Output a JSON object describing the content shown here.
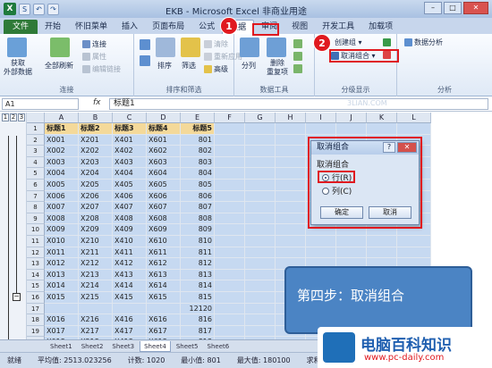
{
  "window": {
    "title": "EKB - Microsoft Excel 非商业用途"
  },
  "qat": {
    "save": "S",
    "undo": "↶",
    "redo": "↷"
  },
  "tabs": [
    "文件",
    "开始",
    "怀旧菜单",
    "插入",
    "页面布局",
    "公式",
    "数据",
    "审阅",
    "视图",
    "开发工具",
    "加载项"
  ],
  "ribbon": {
    "get_external": "获取\n外部数据",
    "refresh_all": "全部刷新",
    "connections": "连接",
    "properties": "属性",
    "edit_links": "编辑链接",
    "group_connections": "连接",
    "sort": "排序",
    "filter": "筛选",
    "clear": "清除",
    "reapply": "重新应用",
    "advanced": "高级",
    "group_sort": "排序和筛选",
    "split": "分列",
    "remove_dup": "删除\n重复项",
    "group_tools": "数据工具",
    "group": "创建组",
    "ungroup": "取消组合",
    "group_outline": "分级显示",
    "data_analysis": "数据分析",
    "group_analysis": "分析"
  },
  "formula": {
    "namebox": "A1",
    "fx": "fx",
    "value": "标题1"
  },
  "columns": [
    "A",
    "B",
    "C",
    "D",
    "E",
    "F",
    "G",
    "H",
    "I",
    "J",
    "K",
    "L"
  ],
  "rows": [
    {
      "n": "1",
      "c": [
        "标题1",
        "标题2",
        "标题3",
        "标题4",
        "标题5"
      ]
    },
    {
      "n": "2",
      "c": [
        "X001",
        "X201",
        "X401",
        "X601",
        "801"
      ]
    },
    {
      "n": "3",
      "c": [
        "X002",
        "X202",
        "X402",
        "X602",
        "802"
      ]
    },
    {
      "n": "4",
      "c": [
        "X003",
        "X203",
        "X403",
        "X603",
        "803"
      ]
    },
    {
      "n": "5",
      "c": [
        "X004",
        "X204",
        "X404",
        "X604",
        "804"
      ]
    },
    {
      "n": "6",
      "c": [
        "X005",
        "X205",
        "X405",
        "X605",
        "805"
      ]
    },
    {
      "n": "7",
      "c": [
        "X006",
        "X206",
        "X406",
        "X606",
        "806"
      ]
    },
    {
      "n": "8",
      "c": [
        "X007",
        "X207",
        "X407",
        "X607",
        "807"
      ]
    },
    {
      "n": "9",
      "c": [
        "X008",
        "X208",
        "X408",
        "X608",
        "808"
      ]
    },
    {
      "n": "10",
      "c": [
        "X009",
        "X209",
        "X409",
        "X609",
        "809"
      ]
    },
    {
      "n": "11",
      "c": [
        "X010",
        "X210",
        "X410",
        "X610",
        "810"
      ]
    },
    {
      "n": "12",
      "c": [
        "X011",
        "X211",
        "X411",
        "X611",
        "811"
      ]
    },
    {
      "n": "13",
      "c": [
        "X012",
        "X212",
        "X412",
        "X612",
        "812"
      ]
    },
    {
      "n": "14",
      "c": [
        "X013",
        "X213",
        "X413",
        "X613",
        "813"
      ]
    },
    {
      "n": "15",
      "c": [
        "X014",
        "X214",
        "X414",
        "X614",
        "814"
      ]
    },
    {
      "n": "16",
      "c": [
        "X015",
        "X215",
        "X415",
        "X615",
        "815"
      ]
    },
    {
      "n": "17",
      "c": [
        "",
        "",
        "",
        "",
        "12120"
      ]
    },
    {
      "n": "18",
      "c": [
        "X016",
        "X216",
        "X416",
        "X616",
        "816"
      ]
    },
    {
      "n": "19",
      "c": [
        "X017",
        "X217",
        "X417",
        "X617",
        "817"
      ]
    },
    {
      "n": "20",
      "c": [
        "X018",
        "X218",
        "X418",
        "X618",
        "818"
      ]
    },
    {
      "n": "21",
      "c": [
        "X019",
        "X219",
        "X419",
        "X619",
        "819"
      ]
    }
  ],
  "dialog": {
    "title": "取消组合",
    "help": "?",
    "close": "✕",
    "section": "取消组合",
    "opt_row": "行(R)",
    "opt_col": "列(C)",
    "ok": "确定",
    "cancel": "取消"
  },
  "badges": {
    "one": "1",
    "two": "2"
  },
  "step_text": "第四步：取消组合",
  "sheet_tabs": [
    "Sheet1",
    "Sheet2",
    "Sheet3",
    "Sheet4",
    "Sheet5",
    "Sheet6"
  ],
  "active_sheet": "Sheet4",
  "status": {
    "mode": "就绪",
    "avg": "平均值: 2513.023256",
    "count": "计数: 1020",
    "min": "最小值: 801",
    "max": "最大值: 180100",
    "sum": "求和: 54"
  },
  "watermark": {
    "brand": "电脑百科知识",
    "url": "www.pc-daily.com",
    "ghost": "3LIAN.COM"
  }
}
